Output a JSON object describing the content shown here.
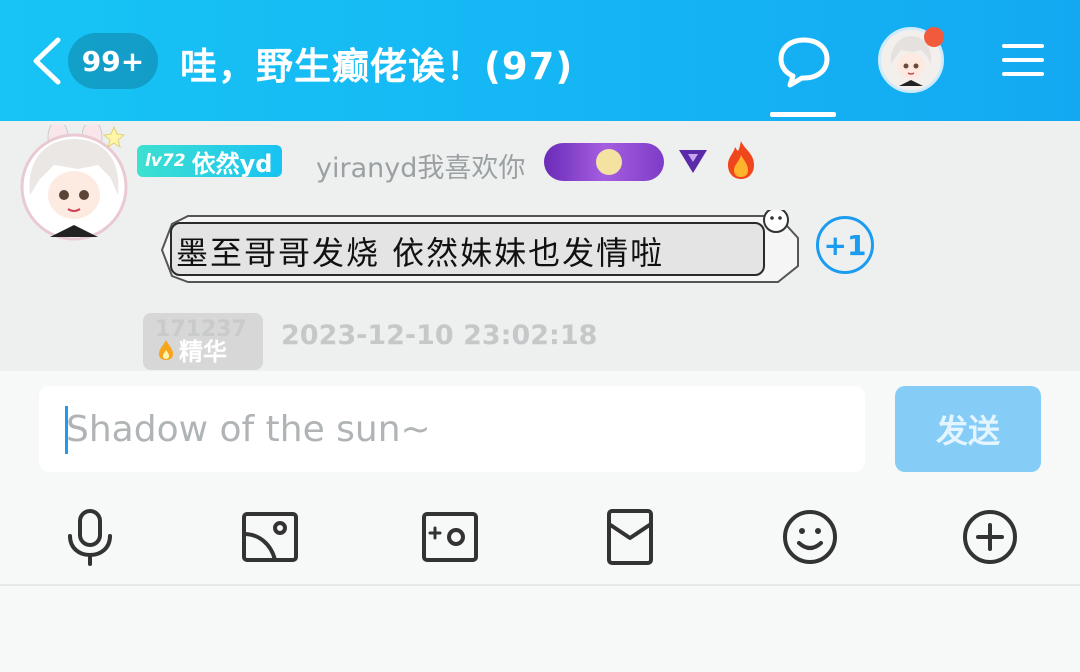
{
  "header": {
    "unread_badge": "99+",
    "group_title": "哇，野生癫佬诶！(97)",
    "icons": [
      "back-icon",
      "chat-bubble-icon",
      "avatar",
      "menu-icon"
    ]
  },
  "message": {
    "level_prefix": "lv72",
    "level_name": "依然yd",
    "nickname": "yiranyd我喜欢你",
    "text": "墨至哥哥发烧 依然妹妹也发情啦",
    "plus_one": "+1",
    "essence_id": "171237",
    "essence_label": "精华",
    "timestamp": "2023-12-10 23:02:18"
  },
  "input": {
    "placeholder": "Shadow of the sun~",
    "send_label": "发送"
  },
  "toolbar": {
    "icons": [
      "microphone-icon",
      "image-icon",
      "camera-icon",
      "red-packet-icon",
      "emoji-icon",
      "plus-circle-icon"
    ]
  },
  "colors": {
    "header_start": "#17c4f5",
    "header_end": "#13a9f2",
    "accent_blue": "#1b9cf0",
    "send_button": "#85cdf7",
    "notification_red": "#f25a3c"
  }
}
